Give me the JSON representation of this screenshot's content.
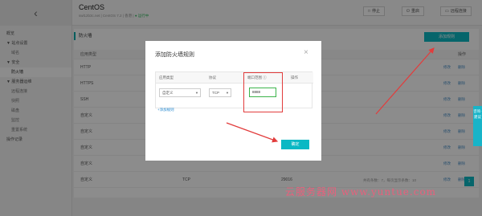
{
  "sidebar": {
    "back_icon": "chevron-left-icon",
    "items": [
      {
        "label": "概览",
        "type": "top"
      },
      {
        "label": "▼ 站点设置",
        "type": "top"
      },
      {
        "label": "域名",
        "type": "sub"
      },
      {
        "label": "▼ 安全",
        "type": "top"
      },
      {
        "label": "防火墙",
        "type": "sub-active"
      },
      {
        "label": "▼ 服务器运维",
        "type": "top"
      },
      {
        "label": "远程连接",
        "type": "sub"
      },
      {
        "label": "快照",
        "type": "sub"
      },
      {
        "label": "磁盘",
        "type": "sub"
      },
      {
        "label": "监控",
        "type": "sub"
      },
      {
        "label": "重置系统",
        "type": "sub"
      },
      {
        "label": "操作记录",
        "type": "top"
      }
    ]
  },
  "header": {
    "title": "CentOS",
    "subtitle": "swl12b3c.net | CentOS 7.2 | 香港 |",
    "status": "● 运行中",
    "buttons": {
      "stop": "停止",
      "restart": "重启",
      "reset_password": "远程连接"
    }
  },
  "main": {
    "section_title": "防火墙",
    "add_rule_button": "添加规则",
    "columns": {
      "app_type": "应用类型",
      "action": "操作"
    },
    "rows": [
      {
        "app": "HTTP",
        "proto": "",
        "port": "",
        "edit": "修改",
        "delete": "删除"
      },
      {
        "app": "HTTPS",
        "proto": "",
        "port": "",
        "edit": "修改",
        "delete": "删除"
      },
      {
        "app": "SSH",
        "proto": "",
        "port": "",
        "edit": "修改",
        "delete": "删除"
      },
      {
        "app": "自定义",
        "proto": "",
        "port": "",
        "edit": "修改",
        "delete": "删除"
      },
      {
        "app": "自定义",
        "proto": "",
        "port": "",
        "edit": "修改",
        "delete": "删除"
      },
      {
        "app": "自定义",
        "proto": "",
        "port": "",
        "edit": "修改",
        "delete": "删除"
      },
      {
        "app": "自定义",
        "proto": "",
        "port": "",
        "edit": "修改",
        "delete": "删除"
      },
      {
        "app": "自定义",
        "proto": "TCP",
        "port": "29016",
        "edit": "修改",
        "delete": "删除"
      }
    ],
    "pager_text": "共有条数：7，每页显示条数：10",
    "page": "1"
  },
  "modal": {
    "title": "添加防火墙规则",
    "columns": {
      "app_type": "应用类型",
      "protocol": "协议",
      "port_range": "端口范围 ⓘ",
      "action": "操作"
    },
    "app_type_value": "自定义",
    "protocol_value": "TCP",
    "port_value": "8888",
    "add_link": "+添加规则",
    "ok_button": "确定"
  },
  "side_tab": "咨询·建议",
  "watermark": "云服务器网 www.yuntue.com",
  "colors": {
    "accent": "#0bb8c4",
    "highlight": "#e23c3c",
    "watermark": "#e8607c"
  }
}
